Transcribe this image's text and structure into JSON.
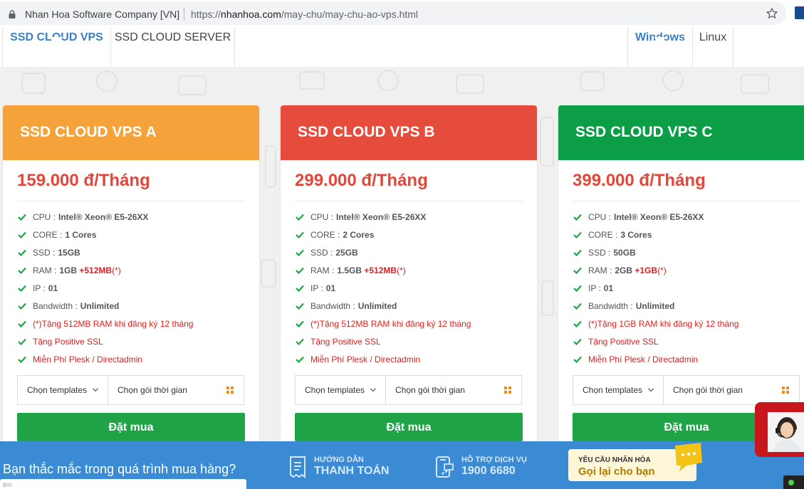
{
  "browser": {
    "site_name": "Nhan Hoa Software Company [VN]",
    "url_prefix": "https://",
    "url_host": "nhanhoa.com",
    "url_path": "/may-chu/may-chu-ao-vps.html"
  },
  "tabs": {
    "left": [
      {
        "label": "SSD CLOUD VPS",
        "active": true
      },
      {
        "label": "SSD CLOUD SERVER",
        "active": false
      }
    ],
    "right": [
      {
        "label": "Windows",
        "active": true
      },
      {
        "label": "Linux",
        "active": false
      }
    ]
  },
  "colors": {
    "plan_a": "#f5a23a",
    "plan_b": "#e64c3c",
    "plan_c": "#0c9e46",
    "price": "#e2473a",
    "buy_button": "#1ea446",
    "accent_blue": "#3b7fc4",
    "bottom_bar": "#3a8bd3"
  },
  "plans": [
    {
      "name": "SSD CLOUD VPS A",
      "price": "159.000 đ/Tháng",
      "cpu_label": "CPU :",
      "cpu": "Intel® Xeon® E5-26XX",
      "core_label": "CORE :",
      "core": "1 Cores",
      "ssd_label": "SSD :",
      "ssd": "15GB",
      "ram_label": "RAM :",
      "ram": "1GB",
      "ram_bonus": "+512MB",
      "ram_note": "(*)",
      "ip_label": "IP :",
      "ip": "01",
      "bw_label": "Bandwidth :",
      "bw": "Unlimited",
      "promo1": "(*)Tặng 512MB RAM khi đăng ký 12 tháng",
      "promo2": "Tặng Positive SSL",
      "promo3": "Miễn Phí Plesk / Directadmin",
      "select_template": "Chọn templates",
      "select_period": "Chọn gói thời gian",
      "buy": "Đặt mua"
    },
    {
      "name": "SSD CLOUD VPS B",
      "price": "299.000 đ/Tháng",
      "cpu_label": "CPU :",
      "cpu": "Intel® Xeon® E5-26XX",
      "core_label": "CORE :",
      "core": "2 Cores",
      "ssd_label": "SSD :",
      "ssd": "25GB",
      "ram_label": "RAM :",
      "ram": "1.5GB",
      "ram_bonus": "+512MB",
      "ram_note": "(*)",
      "ip_label": "IP :",
      "ip": "01",
      "bw_label": "Bandwidth :",
      "bw": "Unlimited",
      "promo1": "(*)Tặng 512MB RAM khi đăng ký 12 tháng",
      "promo2": "Tặng Positive SSL",
      "promo3": "Miễn Phí Plesk / Directadmin",
      "select_template": "Chọn templates",
      "select_period": "Chọn gói thời gian",
      "buy": "Đặt mua"
    },
    {
      "name": "SSD CLOUD VPS C",
      "price": "399.000 đ/Tháng",
      "cpu_label": "CPU :",
      "cpu": "Intel® Xeon® E5-26XX",
      "core_label": "CORE :",
      "core": "3 Cores",
      "ssd_label": "SSD :",
      "ssd": "50GB",
      "ram_label": "RAM :",
      "ram": "2GB",
      "ram_bonus": "+1GB",
      "ram_note": "(*)",
      "ip_label": "IP :",
      "ip": "01",
      "bw_label": "Bandwidth :",
      "bw": "Unlimited",
      "promo1": "(*)Tặng 1GB RAM khi đăng ký 12 tháng",
      "promo2": "Tặng Positive SSL",
      "promo3": "Miễn Phí Plesk / Directadmin",
      "select_template": "Chọn templates",
      "select_period": "Chọn gói thời gian",
      "buy": "Đặt mua"
    }
  ],
  "bottom": {
    "question": "Bạn thắc mắc trong quá trình mua hàng?",
    "input_placeholder": "ệm",
    "guide_small": "HƯỚNG DẪN",
    "guide_big": "THANH TOÁN",
    "support_small": "HỖ TRỢ DỊCH VỤ",
    "support_big": "1900 6680",
    "callback_small": "YÊU CẦU NHÂN HÒA",
    "callback_big": "Gọi lại cho bạn"
  }
}
